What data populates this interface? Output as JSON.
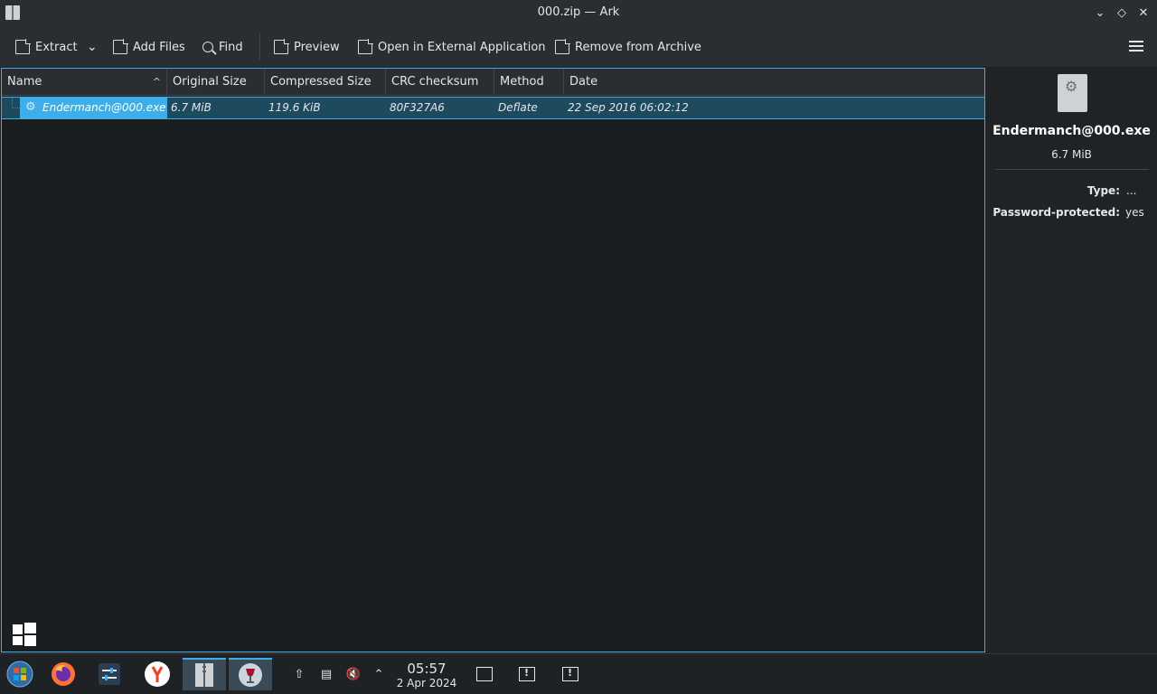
{
  "window": {
    "title": "000.zip — Ark",
    "controls": {
      "minimize": "⌄",
      "maximize": "◇",
      "close": "✕"
    }
  },
  "toolbar": {
    "extract_label": "Extract",
    "add_files_label": "Add Files",
    "find_label": "Find",
    "preview_label": "Preview",
    "open_external_label": "Open in External Application",
    "remove_label": "Remove from Archive",
    "dropdown_arrow": "⌄"
  },
  "table": {
    "columns": [
      "Name",
      "Original Size",
      "Compressed Size",
      "CRC checksum",
      "Method",
      "Date"
    ],
    "sort_indicator": "^",
    "rows": [
      {
        "name": "Endermanch@000.exe",
        "original_size": "6.7 MiB",
        "compressed_size": "119.6 KiB",
        "crc": "80F327A6",
        "method": "Deflate",
        "date": "22 Sep 2016 06:02:12"
      }
    ]
  },
  "info_panel": {
    "file_name": "Endermanch@000.exe",
    "file_size": "6.7 MiB",
    "type_label": "Type:",
    "type_value": "...",
    "password_label": "Password-protected:",
    "password_value": "yes"
  },
  "taskbar": {
    "time": "05:57",
    "date": "2 Apr 2024",
    "apps": [
      "start-button",
      "firefox",
      "system-settings",
      "yandex-browser",
      "ark",
      "wine"
    ]
  },
  "colors": {
    "accent": "#3daee9",
    "background": "#202326",
    "list_background": "#1b1e20"
  }
}
